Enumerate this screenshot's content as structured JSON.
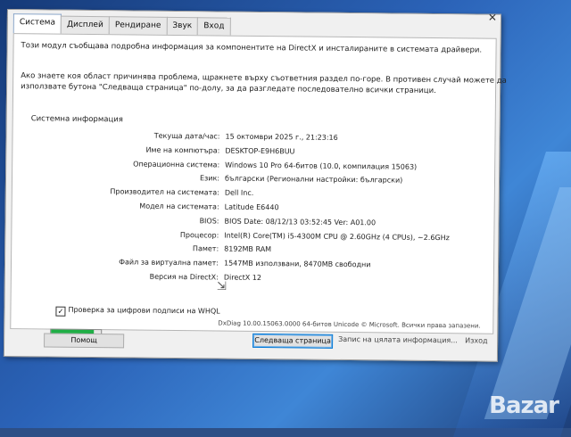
{
  "tabs": [
    "Система",
    "Дисплей",
    "Рендиране",
    "Звук",
    "Вход"
  ],
  "intro": "Този модул съобщава подробна информация за компонентите на DirectX и инсталираните в системата драйвери.",
  "hint_line1": "Ако знаете коя област причинява проблема, щракнете върху съответния раздел по-горе. В противен случай можете да",
  "hint_line2": "използвате бутона \"Следваща страница\" по-долу, за да разгледате последователно всички страници.",
  "section_title": "Системна информация",
  "info": [
    {
      "label": "Текуща дата/час:",
      "value": "15 октомври 2025 г., 21:23:16"
    },
    {
      "label": "Име на компютъра:",
      "value": "DESKTOP-E9H6BUU"
    },
    {
      "label": "Операционна система:",
      "value": "Windows 10 Pro 64-битов (10.0, компилация 15063)"
    },
    {
      "label": "Език:",
      "value": "български (Регионални настройки: български)"
    },
    {
      "label": "Производител на системата:",
      "value": "Dell Inc."
    },
    {
      "label": "Модел на системата:",
      "value": "Latitude E6440"
    },
    {
      "label": "BIOS:",
      "value": "BIOS Date: 08/12/13 03:52:45 Ver: A01.00"
    },
    {
      "label": "Процесор:",
      "value": "Intel(R) Core(TM) i5-4300M CPU @ 2.60GHz (4 CPUs), ~2.6GHz"
    },
    {
      "label": "Памет:",
      "value": "8192MB RAM"
    },
    {
      "label": "Файл за виртуална памет:",
      "value": "1547MB използвани, 8470MB свободни"
    },
    {
      "label": "Версия на DirectX:",
      "value": "DirectX 12"
    }
  ],
  "whql_label": "Проверка за цифрови подписи на WHQL",
  "progress": 0.85,
  "footer_version": "DxDiag 10.00.15063.0000 64-битов Unicode  © Microsoft. Всички права запазени.",
  "buttons": {
    "help": "Помощ",
    "next_page": "Следваща страница",
    "save_all": "Запис на цялата информация...",
    "exit": "Изход"
  },
  "colors": {
    "progress_fill": "#1fae45",
    "accent": "#0078d7"
  },
  "watermark": "Bazar"
}
